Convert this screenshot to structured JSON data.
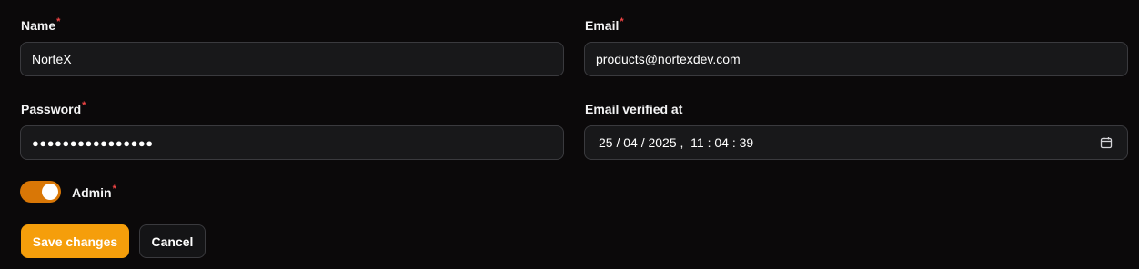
{
  "form": {
    "name": {
      "label": "Name",
      "required_mark": "*",
      "value": "NorteX"
    },
    "email": {
      "label": "Email",
      "required_mark": "*",
      "value": "products@nortexdev.com"
    },
    "password": {
      "label": "Password",
      "required_mark": "*",
      "value": "●●●●●●●●●●●●●●●●"
    },
    "email_verified_at": {
      "label": "Email verified at",
      "value": "25 / 04 / 2025 ,  11 : 04 : 39",
      "icon": "calendar-icon"
    },
    "admin": {
      "label": "Admin",
      "required_mark": "*",
      "checked": true
    },
    "buttons": {
      "save_label": "Save changes",
      "cancel_label": "Cancel"
    }
  },
  "colors": {
    "background": "#0b090a",
    "input_background": "#18181a",
    "border": "#3a3a3e",
    "accent": "#f59e0b",
    "toggle_on": "#d97706",
    "required": "#ef4444"
  }
}
